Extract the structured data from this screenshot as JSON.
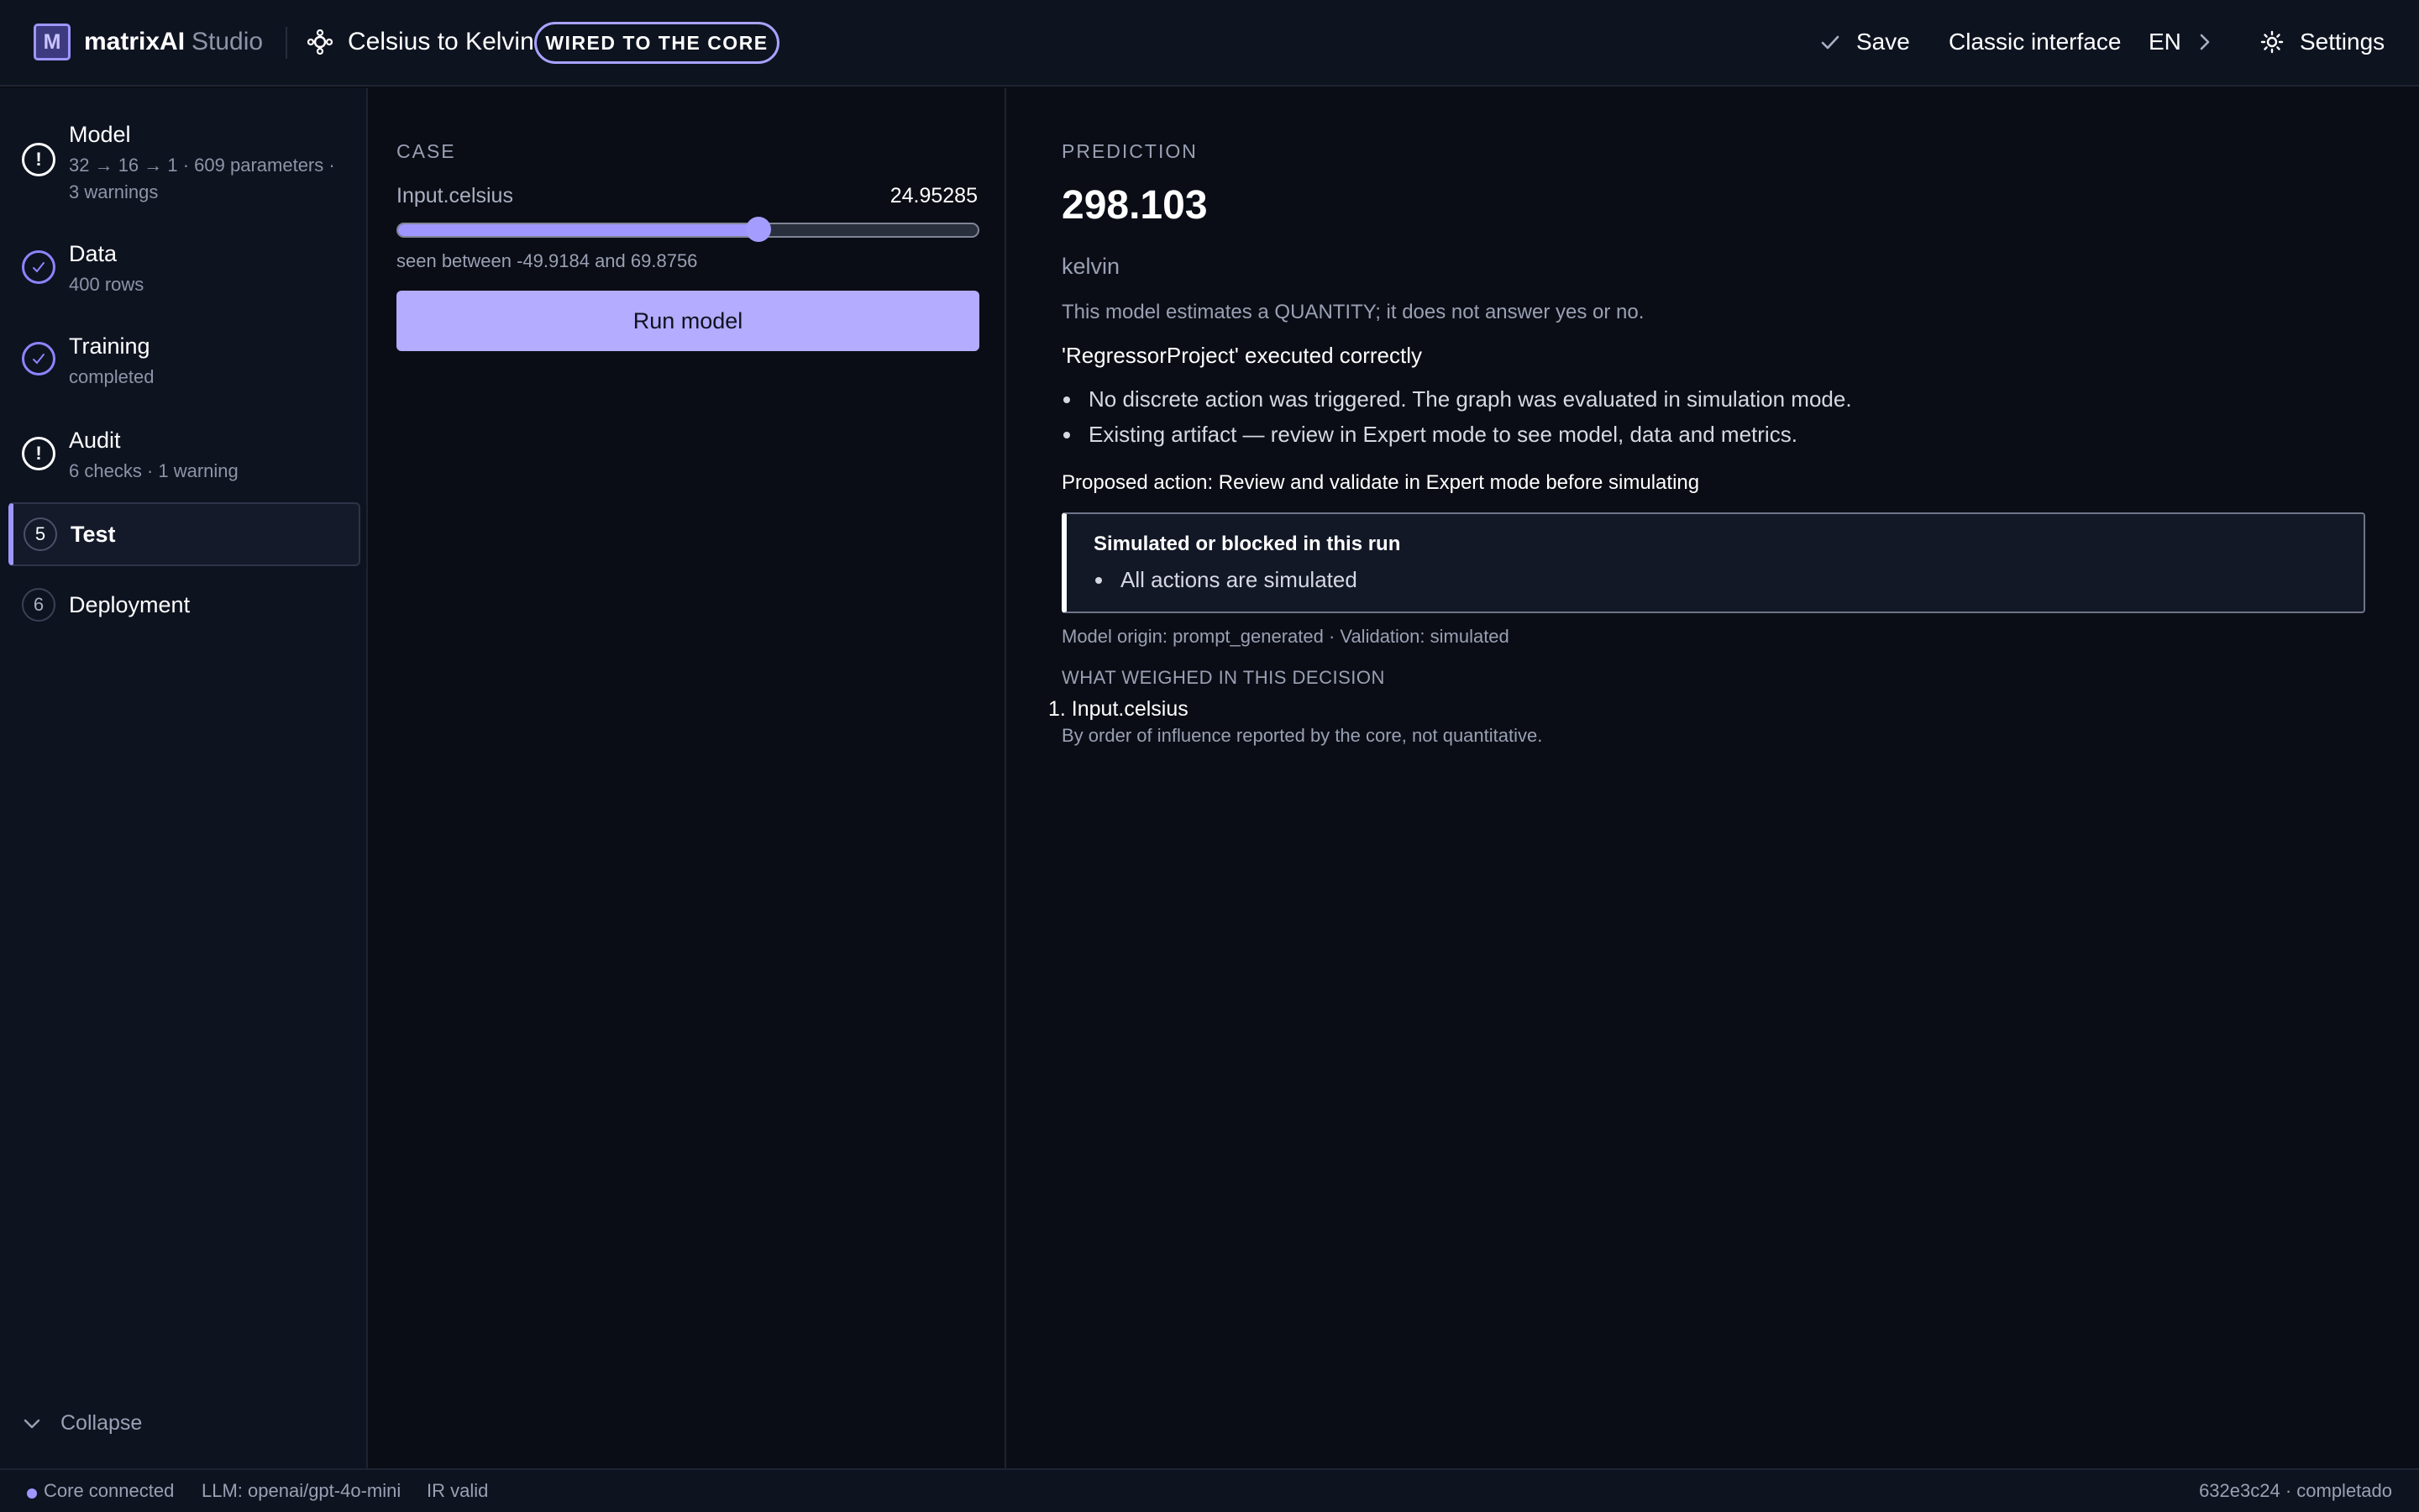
{
  "header": {
    "logo_letter": "M",
    "brand_name": "matrixAI",
    "brand_sub": "Studio",
    "project_title": "Celsius to Kelvin",
    "badge": "WIRED TO THE CORE",
    "save_label": "Save",
    "classic_label": "Classic interface",
    "lang_label": "EN",
    "settings_label": "Settings"
  },
  "sidebar": {
    "steps": [
      {
        "title": "Model",
        "sub_line1": "32 → 16 → 1 · 609 parameters ·",
        "sub_line2": "3 warnings",
        "status": "warning",
        "icon": "exclamation-icon"
      },
      {
        "title": "Data",
        "sub_line1": "400 rows",
        "status": "done",
        "icon": "check-icon"
      },
      {
        "title": "Training",
        "sub_line1": "completed",
        "status": "done",
        "icon": "check-icon"
      },
      {
        "title": "Audit",
        "sub_line1": "6 checks · 1 warning",
        "status": "warning",
        "icon": "exclamation-icon"
      },
      {
        "number": "5",
        "title": "Test",
        "status": "active"
      },
      {
        "number": "6",
        "title": "Deployment",
        "status": "pending"
      }
    ],
    "collapse_label": "Collapse"
  },
  "case": {
    "section_label": "CASE",
    "field_name": "Input.celsius",
    "field_value": "24.95285",
    "slider_fraction": 0.6218,
    "seen_range": "seen between -49.9184 and 69.8756",
    "run_label": "Run model"
  },
  "prediction": {
    "section_label": "PREDICTION",
    "value": "298.103",
    "unit": "kelvin",
    "note": "This model estimates a QUANTITY; it does not answer yes or no.",
    "executed": "'RegressorProject' executed correctly",
    "bullets": [
      "No discrete action was triggered. The graph was evaluated in simulation mode.",
      "Existing artifact — review in Expert mode to see model, data and metrics."
    ],
    "proposed_action": "Proposed action: Review and validate in Expert mode before simulating",
    "simulated_box": {
      "title": "Simulated or blocked in this run",
      "items": [
        "All actions are simulated"
      ]
    },
    "origin": "Model origin: prompt_generated · Validation: simulated",
    "weighed_label": "WHAT WEIGHED IN THIS DECISION",
    "weighed_items": [
      "Input.celsius"
    ],
    "weighed_note": "By order of influence reported by the core, not quantitative."
  },
  "status_bar": {
    "core": "Core connected",
    "llm": "LLM: openai/gpt-4o-mini",
    "ir": "IR valid",
    "run_id": "632e3c24 · completado"
  },
  "colors": {
    "accent": "#9f96ff",
    "button": "#b3acff",
    "background": "#0a0d15",
    "panel": "#0e1320"
  }
}
